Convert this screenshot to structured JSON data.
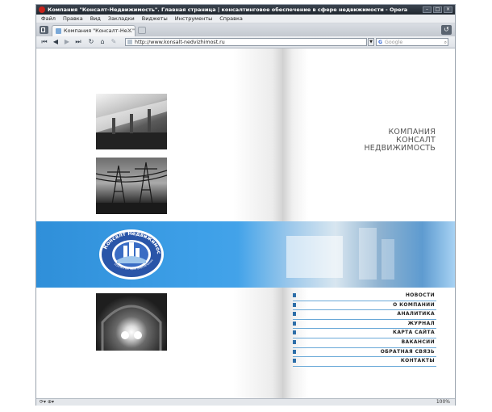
{
  "window": {
    "title": "Компания \"Консалт-Недвижимость\". Главная страница | консалтинговое обеспечение в сфере недвижимости - Opera",
    "controls": [
      "–",
      "□",
      "×"
    ]
  },
  "menubar": {
    "items": [
      "Файл",
      "Правка",
      "Вид",
      "Закладки",
      "Виджеты",
      "Инструменты",
      "Справка"
    ]
  },
  "tabs": [
    {
      "label": "Компания \"Консалт-Не...\"",
      "close": "×"
    }
  ],
  "toolbar": {
    "nav_icons": [
      "back-end-icon",
      "back-icon",
      "forward-icon",
      "forward-end-icon",
      "reload-icon",
      "home-icon",
      "edit-icon"
    ],
    "nav_glyphs": [
      "⏮",
      "◀",
      "▶",
      "⏭",
      "↻",
      "⌂",
      "✎"
    ],
    "url": "http://www.konsalt-nedvizhimost.ru",
    "search_placeholder": "Google",
    "search_engine_glyph": "G"
  },
  "page": {
    "company_name_lines": [
      "КОМПАНИЯ",
      "КОНСАЛТ",
      "НЕДВИЖИМОСТЬ"
    ],
    "logo_text_top": "Консалт Недвижимость",
    "logo_text_bottom": "консалтинговое обеспечение",
    "nav_menu": [
      "НОВОСТИ",
      "О КОМПАНИИ",
      "АНАЛИТИКА",
      "ЖУРНАЛ",
      "КАРТА САЙТА",
      "ВАКАНСИИ",
      "ОБРАТНАЯ СВЯЗЬ",
      "КОНТАКТЫ"
    ]
  },
  "statusbar": {
    "left": "⟳▾  ⊕▾",
    "zoom": "100%"
  },
  "colors": {
    "band_blue": "#3ea0e8",
    "menu_line": "#6aa9d8",
    "bullet": "#2d6ea8"
  }
}
